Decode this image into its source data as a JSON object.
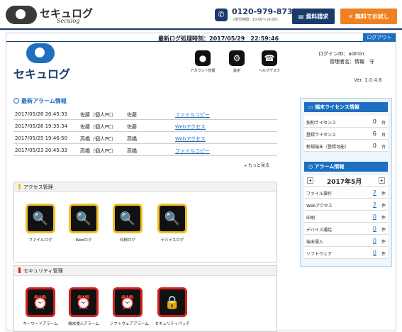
{
  "site": {
    "brand": "セキュログ",
    "brand_sub": "Seculog",
    "phone": "0120-979-873",
    "phone_hours": "(受付時間：10:00〜18:00)",
    "docs_label": "資料請求",
    "trial_label": "無料でお試し"
  },
  "app": {
    "last_log_label": "最新ログ処理時刻：2017/05/29　22:59:46",
    "logout_label": "ログアウト",
    "app_name": "セキュログ",
    "login_id": "ログインID：admin",
    "admin_name": "管理者名：情報　守",
    "version": "Ver. 1.0.4.6",
    "top_icons": [
      {
        "label": "アカウント管理",
        "icon": "account-icon"
      },
      {
        "label": "設定",
        "icon": "gear-icon"
      },
      {
        "label": "ヘルプデスク",
        "icon": "headset-icon"
      }
    ]
  },
  "alarms": {
    "title": "最新アラーム情報",
    "more_label": "もっと見る",
    "rows": [
      {
        "time": "2017/05/26 20:45:33",
        "pc": "佐藤（個人PC）",
        "user": "佐藤",
        "action": "ファイルコピー"
      },
      {
        "time": "2017/05/26 19:35:34",
        "pc": "佐藤（個人PC）",
        "user": "佐藤",
        "action": "Webアクセス"
      },
      {
        "time": "2017/05/25 19:46:50",
        "pc": "高橋（個人PC）",
        "user": "高橋",
        "action": "Webアクセス"
      },
      {
        "time": "2017/05/23 20:45:33",
        "pc": "高橋（個人PC）",
        "user": "高橋",
        "action": "ファイルコピー"
      }
    ]
  },
  "access": {
    "title": "アクセス管理",
    "accent": "#f0c020",
    "tiles": [
      {
        "label": "ファイルログ",
        "icon": "file-search-icon"
      },
      {
        "label": "Webログ",
        "icon": "web-search-icon"
      },
      {
        "label": "印刷ログ",
        "icon": "printer-search-icon"
      },
      {
        "label": "デバイスログ",
        "icon": "device-search-icon"
      }
    ]
  },
  "security": {
    "title": "セキュリティ管理",
    "accent": "#d42020",
    "tiles": [
      {
        "label": "キーワードアラーム",
        "icon": "alarm-clock-icon"
      },
      {
        "label": "端末侵入アラーム",
        "icon": "alarm-clock-icon"
      },
      {
        "label": "ソフトウェアアラーム",
        "icon": "alarm-clock-icon"
      },
      {
        "label": "セキュリティパッチ",
        "icon": "padlock-icon"
      }
    ]
  },
  "license": {
    "title": "端末ライセンス情報",
    "rows": [
      {
        "key": "契約ライセンス",
        "value": "0",
        "unit": "台"
      },
      {
        "key": "登録ライセンス",
        "value": "6",
        "unit": "台"
      },
      {
        "key": "新規端末（登録可能）",
        "value": "0",
        "unit": "台"
      }
    ]
  },
  "alarm_info": {
    "title": "アラーム情報",
    "month": "2017年5月",
    "rows": [
      {
        "key": "ファイル操作",
        "value": "2",
        "unit": "件"
      },
      {
        "key": "Webアクセス",
        "value": "2",
        "unit": "件"
      },
      {
        "key": "印刷",
        "value": "0",
        "unit": "件"
      },
      {
        "key": "デバイス通話",
        "value": "0",
        "unit": "件"
      },
      {
        "key": "端末侵入",
        "value": "0",
        "unit": "件"
      },
      {
        "key": "ソフトウェア",
        "value": "0",
        "unit": "件"
      }
    ]
  }
}
